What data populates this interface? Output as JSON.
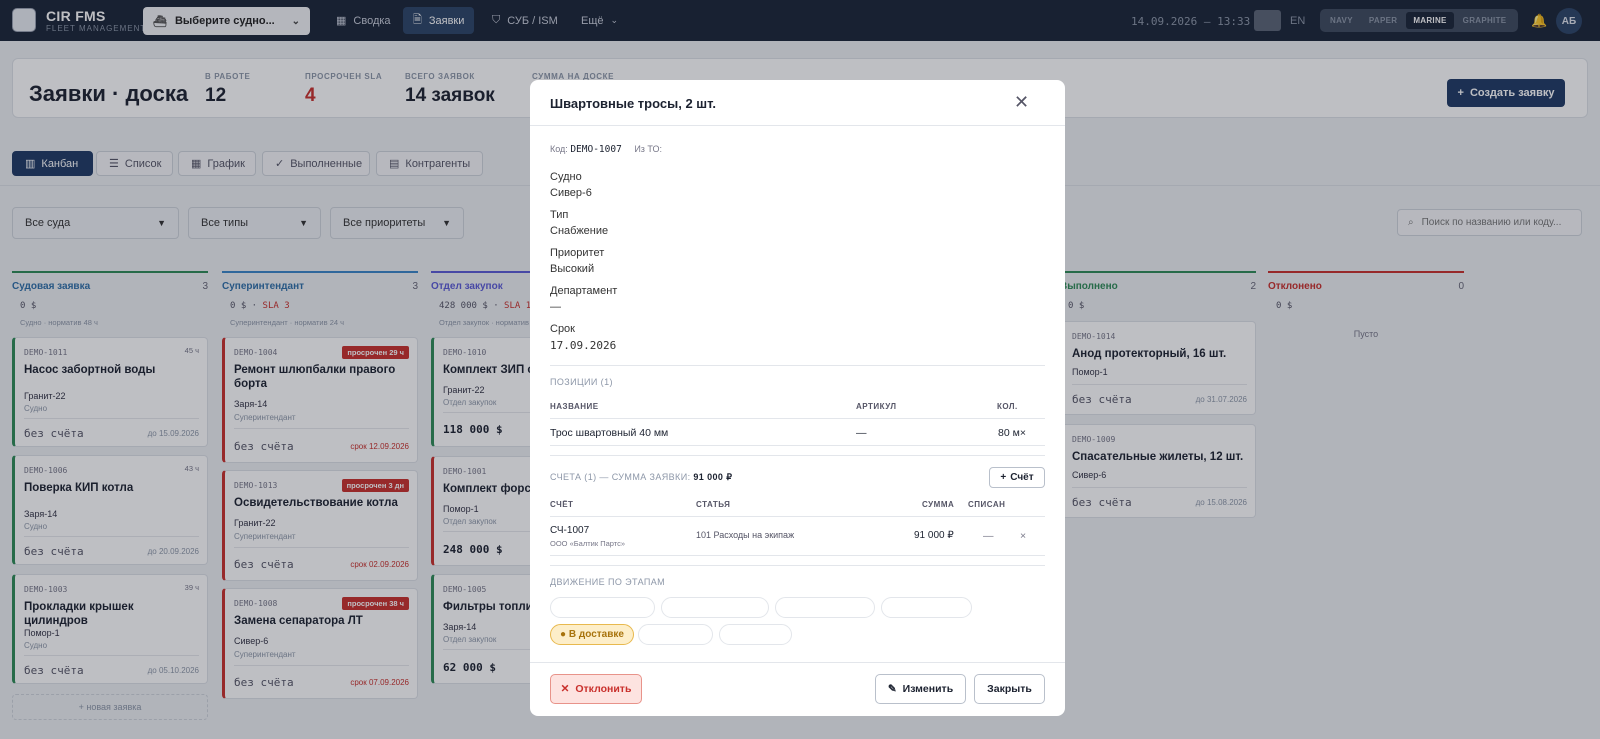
{
  "app": {
    "title": "CIR FMS",
    "subtitle": "FLEET MANAGEMENT",
    "vessel_select": "Выберите судно...",
    "datetime": "14.09.2026 — 13:33",
    "lang": "EN",
    "user_initials": "АБ"
  },
  "nav": [
    "Сводка",
    "Заявки",
    "СУБ / ISM",
    "Ещё"
  ],
  "themes": [
    "NAVY",
    "PAPER",
    "MARINE",
    "GRAPHITE"
  ],
  "header": {
    "title": "Заявки · доска",
    "stats": [
      {
        "label": "В РАБОТЕ",
        "value": "12"
      },
      {
        "label": "ПРОСРОЧЕН SLA",
        "value": "4"
      },
      {
        "label": "ВСЕГО ЗАЯВОК",
        "value": "14 заявок"
      },
      {
        "label": "СУММА НА ДОСКЕ",
        "value": ""
      }
    ],
    "create_label": "Создать заявку"
  },
  "view_tabs": [
    "Канбан",
    "Список",
    "График",
    "Выполненные",
    "Контрагенты"
  ],
  "filters": {
    "vessels": "Все суда",
    "types": "Все типы",
    "priorities": "Все приоритеты",
    "search_placeholder": "Поиск по названию или коду..."
  },
  "columns": [
    {
      "name": "Судовая заявка",
      "count": "3",
      "sum": "0 $",
      "sla": "",
      "norm": "Судно · норматив 48 ч",
      "color": "#2e8b57"
    },
    {
      "name": "Суперинтендант",
      "count": "3",
      "sum": "0 $",
      "sla": "SLA 3",
      "norm": "Суперинтендант · норматив 24 ч",
      "color": "#3a86c8"
    },
    {
      "name": "Отдел закупок",
      "count": "",
      "sum": "428 000 $",
      "sla": "SLA 1",
      "norm": "Отдел закупок · норматив",
      "color": "#5b5bd6"
    },
    {
      "name": "Выполнено",
      "count": "2",
      "sum": "0 $",
      "sla": "",
      "norm": "",
      "color": "#2e8b57"
    },
    {
      "name": "Отклонено",
      "count": "0",
      "sum": "0 $",
      "sla": "",
      "norm": "",
      "color": "#c9302c",
      "empty": "Пусто"
    }
  ],
  "cards": [
    {
      "id": "DEMO-1011",
      "tag": "45 ч",
      "title": "Насос забортной воды",
      "vessel": "Гранит-22",
      "dept": "Судно",
      "amount": "без счёта",
      "due": "до 15.09.2026"
    },
    {
      "id": "DEMO-1006",
      "tag": "43 ч",
      "title": "Поверка КИП котла",
      "vessel": "Заря-14",
      "dept": "Судно",
      "amount": "без счёта",
      "due": "до 20.09.2026"
    },
    {
      "id": "DEMO-1003",
      "tag": "39 ч",
      "title": "Прокладки крышек цилиндров",
      "vessel": "Помор-1",
      "dept": "Судно",
      "amount": "без счёта",
      "due": "до 05.10.2026"
    },
    {
      "id": "DEMO-1004",
      "tag": "просрочен 29 ч",
      "title": "Ремонт шлюпбалки правого борта",
      "vessel": "Заря-14",
      "dept": "Суперинтендант",
      "amount": "без счёта",
      "due": "срок 12.09.2026"
    },
    {
      "id": "DEMO-1013",
      "tag": "просрочен 3 дн",
      "title": "Освидетельствование котла",
      "vessel": "Гранит-22",
      "dept": "Суперинтендант",
      "amount": "без счёта",
      "due": "срок 02.09.2026"
    },
    {
      "id": "DEMO-1008",
      "tag": "просрочен 38 ч",
      "title": "Замена сепаратора ЛТ",
      "vessel": "Сивер-6",
      "dept": "Суперинтендант",
      "amount": "без счёта",
      "due": "срок 07.09.2026"
    },
    {
      "id": "DEMO-1010",
      "tag": "",
      "title": "Комплект ЗИП се",
      "vessel": "Гранит-22",
      "dept": "Отдел закупок",
      "amount": "118 000 $",
      "due": ""
    },
    {
      "id": "DEMO-1001",
      "tag": "",
      "title": "Комплект форсун",
      "vessel": "Помор-1",
      "dept": "Отдел закупок",
      "amount": "248 000 $",
      "due": ""
    },
    {
      "id": "DEMO-1005",
      "tag": "",
      "title": "Фильтры топлив",
      "vessel": "Заря-14",
      "dept": "Отдел закупок",
      "amount": "62 000 $",
      "due": ""
    },
    {
      "id": "DEMO-1014",
      "tag": "",
      "title": "Анод протекторный, 16 шт.",
      "vessel": "Помор-1",
      "dept": "",
      "amount": "без счёта",
      "due": "до 31.07.2026"
    },
    {
      "id": "DEMO-1009",
      "tag": "",
      "title": "Спасательные жилеты, 12 шт.",
      "vessel": "Сивер-6",
      "dept": "",
      "amount": "без счёта",
      "due": "до 15.08.2026"
    }
  ],
  "new_request": "+ новая заявка",
  "modal": {
    "title": "Швартовные тросы, 2 шт.",
    "code_label": "Код:",
    "code": "DEMO-1007",
    "from_to": "Из ТО:",
    "fields": [
      {
        "label": "Судно",
        "value": "Сивер-6"
      },
      {
        "label": "Тип",
        "value": "Снабжение"
      },
      {
        "label": "Приоритет",
        "value": "Высокий"
      },
      {
        "label": "Департамент",
        "value": "—"
      },
      {
        "label": "Срок",
        "value": "17.09.2026"
      }
    ],
    "positions_title": "ПОЗИЦИИ (1)",
    "positions_headers": [
      "НАЗВАНИЕ",
      "АРТИКУЛ",
      "КОЛ."
    ],
    "positions": [
      {
        "name": "Трос швартовный 40 мм",
        "article": "—",
        "qty": "80 м×"
      }
    ],
    "invoices_title": "СЧЕТА (1) — СУММА ЗАЯВКИ:",
    "invoices_total": "91 000 ₽",
    "add_invoice": "Счёт",
    "invoice_headers": [
      "СЧЁТ",
      "СТАТЬЯ",
      "СУММА",
      "СПИСАН"
    ],
    "invoices": [
      {
        "number": "СЧ-1007",
        "vendor": "ООО «Балтик Партс»",
        "article": "101 Расходы на экипаж",
        "sum": "91 000 ₽",
        "written_off": "—",
        "remove": "×"
      }
    ],
    "stages_title": "ДВИЖЕНИЕ ПО ЭТАПАМ",
    "current_stage": "● В доставке",
    "reject_label": "Отклонить",
    "edit_label": "Изменить",
    "close_label": "Закрыть"
  }
}
